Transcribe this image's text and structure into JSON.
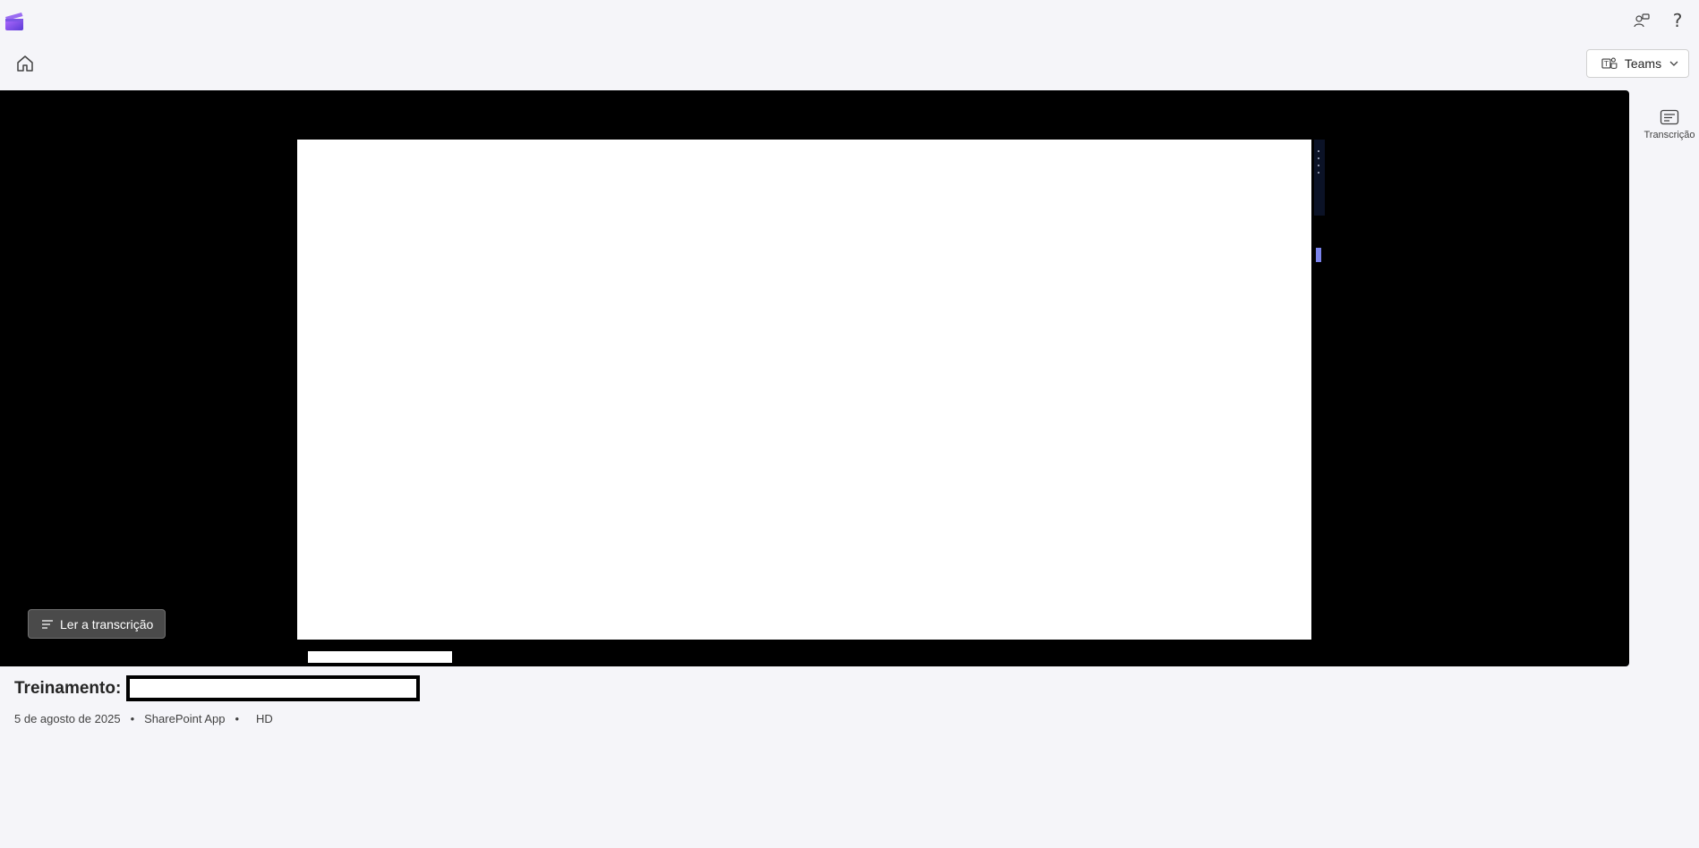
{
  "header": {
    "dropdown_label": "Teams",
    "help_glyph": "?"
  },
  "player": {
    "transcript_button_label": "Ler a transcrição"
  },
  "side_panel": {
    "transcript_label": "Transcrição"
  },
  "video": {
    "title_prefix": "Treinamento:",
    "date": "5 de agosto de 2025",
    "source": "SharePoint App",
    "quality": "HD",
    "separator": "•"
  },
  "colors": {
    "background": "#f5f5f9",
    "player_background": "#000000",
    "accent": "#7b83eb"
  },
  "icons": [
    "clipchamp-logo-icon",
    "share-people-icon",
    "help-icon",
    "home-icon",
    "teams-icon",
    "chevron-down-icon",
    "transcript-lines-icon",
    "transcript-panel-icon"
  ]
}
